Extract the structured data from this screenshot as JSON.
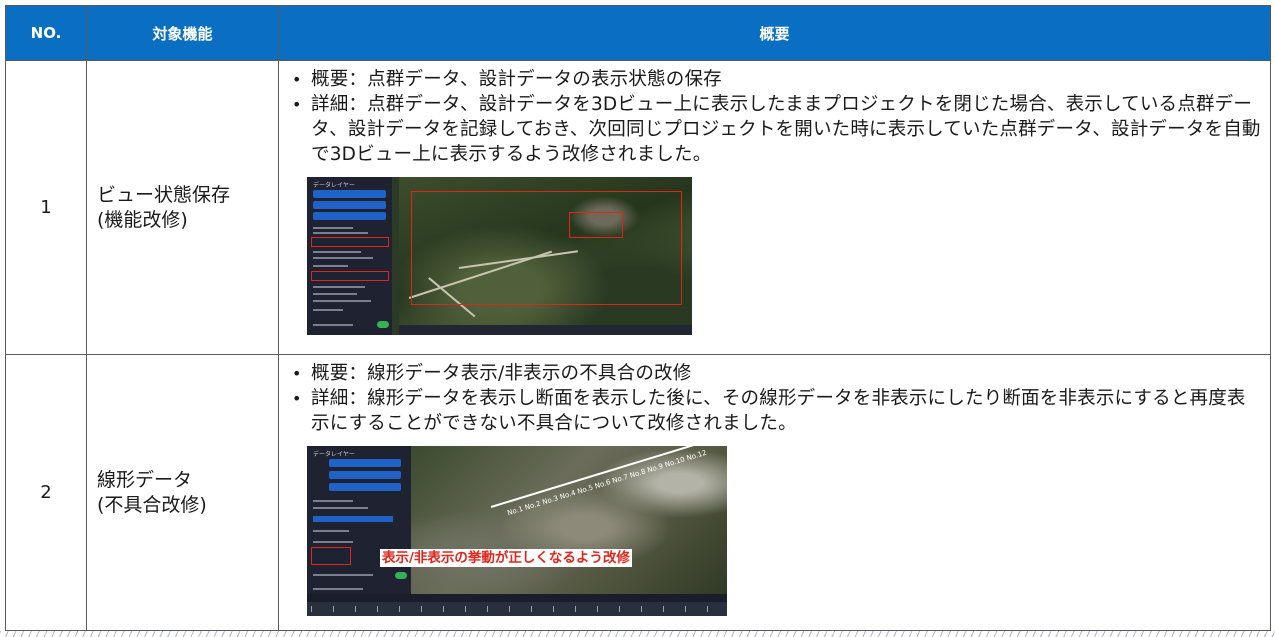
{
  "table": {
    "headers": {
      "no": "NO.",
      "feature": "対象機能",
      "summary": "概要"
    },
    "rows": [
      {
        "no": "1",
        "feature_line1": "ビュー状態保存",
        "feature_line2": "(機能改修)",
        "bullet1": "概要：点群データ、設計データの表示状態の保存",
        "bullet2": "詳細：点群データ、設計データを3Dビュー上に表示したままプロジェクトを閉じた場合、表示している点群データ、設計データを記録しておき、次回同じプロジェクトを開いた時に表示していた点群データ、設計データを自動で3Dビュー上に表示するよう改修されました。",
        "screenshot": {
          "panel_title": "データレイヤー"
        }
      },
      {
        "no": "2",
        "feature_line1": "線形データ",
        "feature_line2": "(不具合改修)",
        "bullet1": "概要：線形データ表示/非表示の不具合の改修",
        "bullet2": "詳細：線形データを表示し断面を表示した後に、その線形データを非表示にしたり断面を非表示にすると再度表示にすることができない不具合について改修されました。",
        "screenshot": {
          "panel_title": "データレイヤー",
          "callout": "表示/非表示の挙動が正しくなるよう改修"
        }
      }
    ]
  },
  "colors": {
    "header_bg": "#0a6fc2",
    "highlight_red": "#e0251b"
  },
  "icons": [
    "eye-icon",
    "play-icon",
    "search-icon"
  ]
}
